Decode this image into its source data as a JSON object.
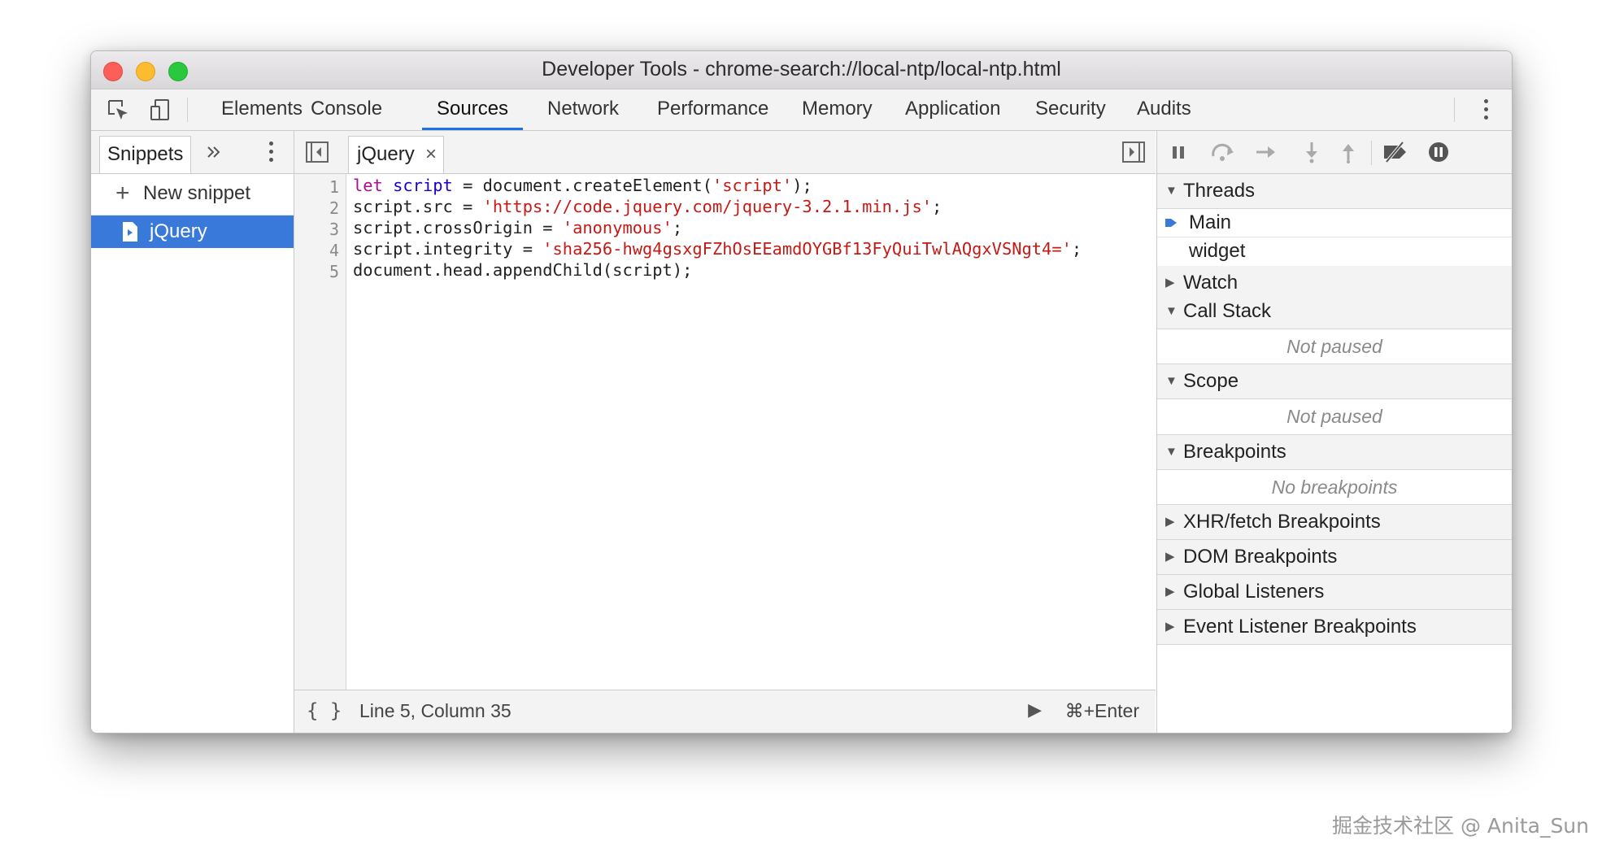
{
  "window": {
    "title": "Developer Tools - chrome-search://local-ntp/local-ntp.html"
  },
  "toolbar": {
    "tabs": [
      {
        "label": "Elements"
      },
      {
        "label": "Console"
      },
      {
        "label": "Sources",
        "active": true
      },
      {
        "label": "Network"
      },
      {
        "label": "Performance"
      },
      {
        "label": "Memory"
      },
      {
        "label": "Application"
      },
      {
        "label": "Security"
      },
      {
        "label": "Audits"
      }
    ]
  },
  "navigator": {
    "tab_label": "Snippets",
    "new_snippet_label": "New snippet",
    "items": [
      {
        "label": "jQuery",
        "selected": true
      }
    ]
  },
  "editor": {
    "tab_label": "jQuery",
    "line_numbers": [
      "1",
      "2",
      "3",
      "4",
      "5"
    ],
    "lines": [
      [
        {
          "t": "let",
          "c": "kw"
        },
        {
          "t": " "
        },
        {
          "t": "script",
          "c": "vr"
        },
        {
          "t": " = document.createElement("
        },
        {
          "t": "'script'",
          "c": "st"
        },
        {
          "t": ");"
        }
      ],
      [
        {
          "t": "script.src = "
        },
        {
          "t": "'https://code.jquery.com/jquery-3.2.1.min.js'",
          "c": "st"
        },
        {
          "t": ";"
        }
      ],
      [
        {
          "t": "script.crossOrigin = "
        },
        {
          "t": "'anonymous'",
          "c": "st"
        },
        {
          "t": ";"
        }
      ],
      [
        {
          "t": "script.integrity = "
        },
        {
          "t": "'sha256-hwg4gsxgFZhOsEEamdOYGBf13FyQuiTwlAQgxVSNgt4='",
          "c": "st"
        },
        {
          "t": ";"
        }
      ],
      [
        {
          "t": "document.head.appendChild(script);"
        }
      ]
    ],
    "footer": {
      "format_label": "{ }",
      "cursor_position": "Line 5, Column 35",
      "run_label": "⌘+Enter"
    }
  },
  "debugger": {
    "threads": {
      "title": "Threads",
      "items": [
        "Main",
        "widget"
      ]
    },
    "watch": {
      "title": "Watch"
    },
    "call_stack": {
      "title": "Call Stack",
      "empty": "Not paused"
    },
    "scope": {
      "title": "Scope",
      "empty": "Not paused"
    },
    "breakpoints": {
      "title": "Breakpoints",
      "empty": "No breakpoints"
    },
    "xhr": {
      "title": "XHR/fetch Breakpoints"
    },
    "dom": {
      "title": "DOM Breakpoints"
    },
    "global": {
      "title": "Global Listeners"
    },
    "event": {
      "title": "Event Listener Breakpoints"
    }
  },
  "watermark": "掘金技术社区 @ Anita_Sun",
  "colors": {
    "accent": "#1a73e8",
    "selection": "#3879d9",
    "string": "#c41a16",
    "keyword": "#aa0d91",
    "variable": "#1c00cf"
  }
}
